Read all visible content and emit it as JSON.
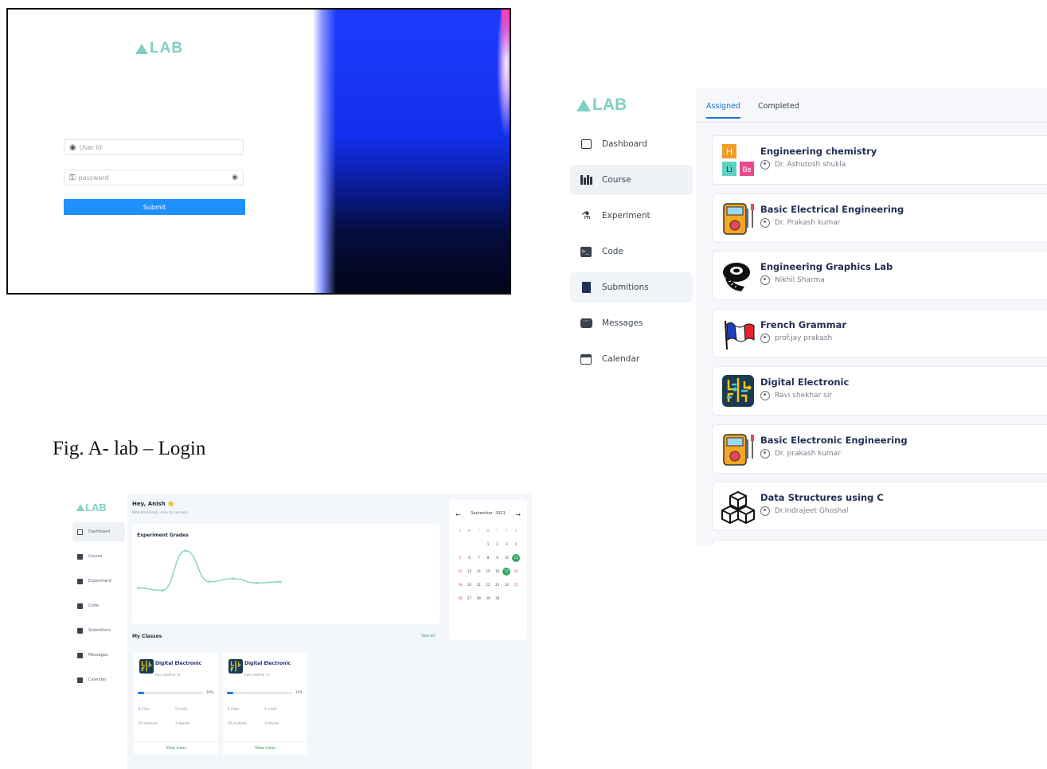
{
  "login": {
    "logo": "LAB",
    "user_placeholder": "User Id",
    "password_placeholder": "password",
    "submit_label": "Submit"
  },
  "caption": "Fig. A- lab – Login",
  "course_panel": {
    "logo": "LAB",
    "nav": [
      {
        "label": "Dashboard",
        "icon": "calendar-box-icon"
      },
      {
        "label": "Course",
        "icon": "books-icon"
      },
      {
        "label": "Experiment",
        "icon": "flask-icon"
      },
      {
        "label": "Code",
        "icon": "terminal-icon"
      },
      {
        "label": "Submitions",
        "icon": "book-icon"
      },
      {
        "label": "Messages",
        "icon": "chat-icon"
      },
      {
        "label": "Calendar",
        "icon": "calendar-icon"
      }
    ],
    "tabs": [
      "Assigned",
      "Completed"
    ],
    "courses": [
      {
        "title": "Engineering chemistry",
        "teacher": "Dr. Ashutosh shukla",
        "icon": "periodic-table-icon"
      },
      {
        "title": "Basic Electrical Engineering",
        "teacher": "Dr. Prakash kumar",
        "icon": "multimeter-icon"
      },
      {
        "title": "Engineering Graphics Lab",
        "teacher": "Nikhil Sharma",
        "icon": "measuring-tape-icon"
      },
      {
        "title": "French Grammar",
        "teacher": "prof.jay prakash",
        "icon": "french-flag-icon"
      },
      {
        "title": "Digital Electronic",
        "teacher": "Ravi shekhar sir",
        "icon": "circuit-icon"
      },
      {
        "title": "Basic Electronic Engineering",
        "teacher": "Dr. prakash kumar",
        "icon": "multimeter-icon"
      },
      {
        "title": "Data Structures using C",
        "teacher": "Dr.Indrajeet Ghoshal",
        "icon": "cubes-icon"
      }
    ]
  },
  "dashboard": {
    "logo": "LAB",
    "nav": [
      "Dashboard",
      "Course",
      "Experiment",
      "Code",
      "Submitions",
      "Messages",
      "Calendar"
    ],
    "greeting": "Hey, Anish",
    "greeting_emoji": "👋",
    "welcome": "Welcome back, nice to see you",
    "grades_title": "Experiment Grades",
    "grades_values": [
      30,
      26,
      90,
      40,
      45,
      38,
      40
    ],
    "my_classes": "My Classes",
    "see_all": "See all",
    "classes": [
      {
        "title": "Digital Electronic",
        "teacher": "Ravi shekhar sir",
        "progress": "10%",
        "progress_value": 0.1,
        "classes": "8 Class",
        "credit": "5 credit",
        "students": "30 students",
        "hours": "3 H/week",
        "action": "View class"
      },
      {
        "title": "Digital Electronic",
        "teacher": "Ravi shekhar sir",
        "progress": "10%",
        "progress_value": 0.1,
        "classes": "8 Class",
        "credit": "5 credit",
        "students": "30 students",
        "hours": "3 H/week",
        "action": "View class"
      }
    ],
    "calendar": {
      "month": "September",
      "year": "2021",
      "weekdays": [
        "S",
        "M",
        "T",
        "W",
        "T",
        "F",
        "S"
      ],
      "days": [
        "",
        "",
        "",
        "1",
        "2",
        "3",
        "4",
        "5",
        "6",
        "7",
        "8",
        "9",
        "10",
        "11",
        "12",
        "13",
        "14",
        "15",
        "16",
        "17",
        "18",
        "19",
        "20",
        "21",
        "22",
        "23",
        "24",
        "25",
        "26",
        "27",
        "28",
        "29",
        "30"
      ],
      "highlighted": [
        "11",
        "17"
      ],
      "weekend_color": "#e04545",
      "highlight_color": "#3aa865"
    }
  },
  "colors": {
    "logo": "#7fd0c6",
    "primary": "#1e90ff",
    "tab_active": "#1e6fd9",
    "green": "#2e9e5b"
  }
}
